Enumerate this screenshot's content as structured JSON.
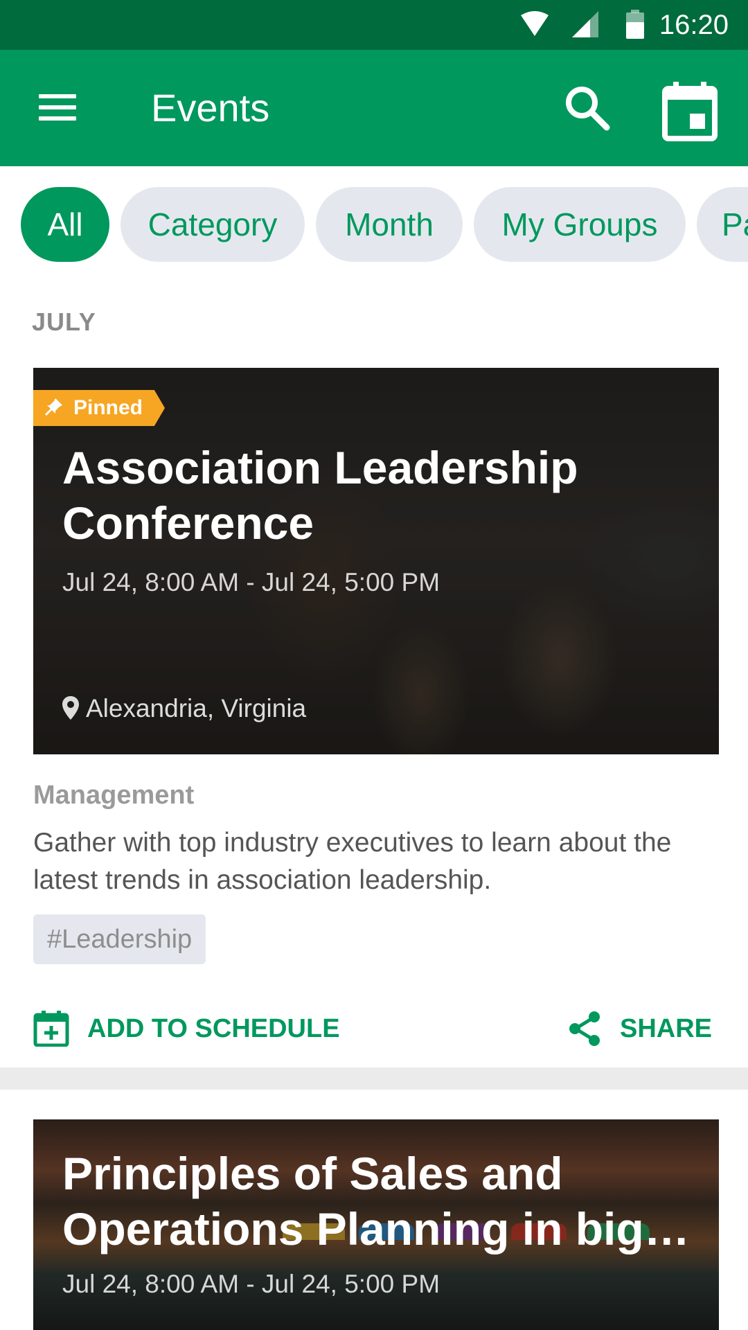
{
  "status_bar": {
    "time": "16:20"
  },
  "app_bar": {
    "title": "Events"
  },
  "filters": [
    {
      "label": "All",
      "active": true
    },
    {
      "label": "Category",
      "active": false
    },
    {
      "label": "Month",
      "active": false
    },
    {
      "label": "My Groups",
      "active": false
    },
    {
      "label": "Pa",
      "active": false
    }
  ],
  "section": {
    "month": "JULY"
  },
  "events": [
    {
      "badge": "Pinned",
      "title": "Association Leadership Conference",
      "date": "Jul 24, 8:00 AM - Jul 24, 5:00 PM",
      "location": "Alexandria, Virginia",
      "category": "Management",
      "description": "Gather with top industry executives to learn about the latest trends in association leadership.",
      "tag": "#Leadership",
      "add_label": "ADD TO SCHEDULE",
      "share_label": "SHARE"
    },
    {
      "title": "Principles of Sales and Operations Planning in big…",
      "date": "Jul 24, 8:00 AM - Jul 24, 5:00 PM"
    }
  ],
  "colors": {
    "primary": "#00985d",
    "primary_dark": "#006b3c",
    "chip_bg": "#e4e8ee",
    "pinned": "#f6a623"
  }
}
